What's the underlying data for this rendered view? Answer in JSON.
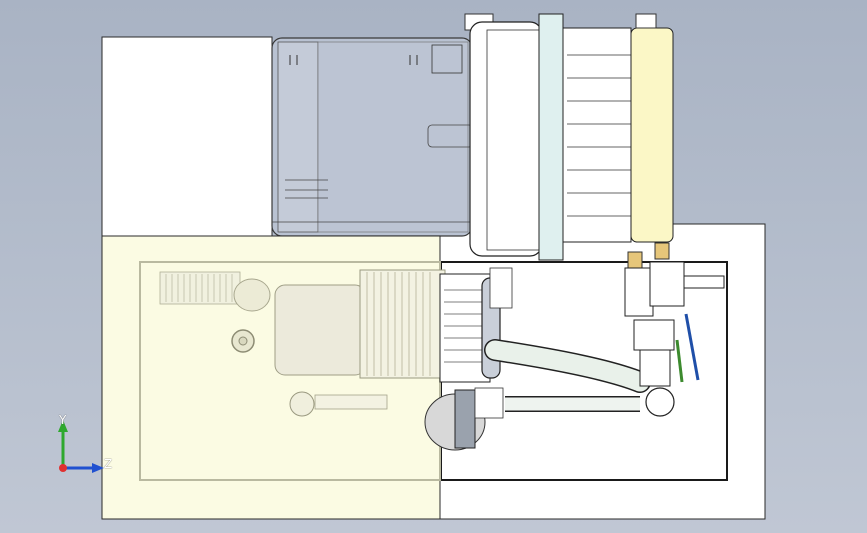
{
  "viewport": {
    "background_top": "#a9b3c4",
    "background_bottom": "#c0c7d4"
  },
  "colors": {
    "panel_white": "#ffffff",
    "panel_yellow": "#fbfbe3",
    "transparent_housing": "#b9c2d2",
    "cooler_cyan": "#dff0ef",
    "cooler_yellow": "#fbf7c6",
    "valve_handle_blue": "#1f4fa8",
    "valve_handle_green": "#3c8a2e",
    "axis_x_red": "#e03030",
    "axis_y_green": "#2ea82e",
    "axis_z_blue": "#2050d0"
  },
  "triad": {
    "y_label": "Y",
    "z_label": "Z"
  },
  "parts": {
    "base_plate": "base-plate",
    "tank": "oil-tank",
    "motor": "electric-motor",
    "cooler": "air-cooler",
    "valve": "ball-valve",
    "pipe": "return-pipe"
  }
}
